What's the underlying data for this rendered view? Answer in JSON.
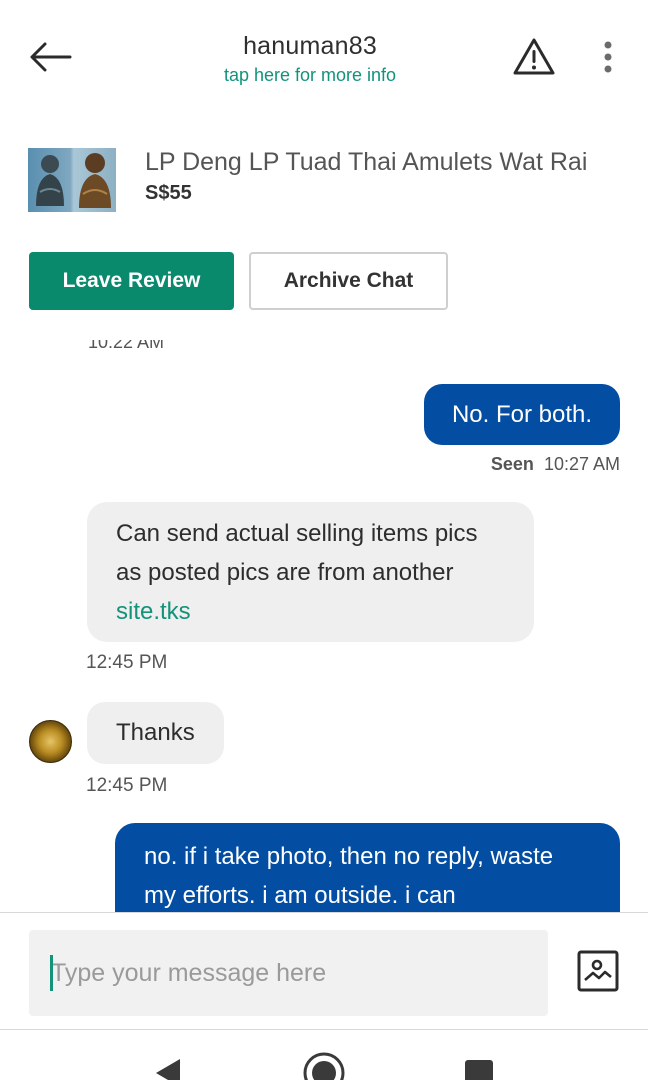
{
  "header": {
    "title": "hanuman83",
    "subtitle": "tap here for more info",
    "back_icon": "arrow-left-icon",
    "report_icon": "warning-triangle-icon",
    "more_icon": "more-vertical-icon"
  },
  "listing": {
    "title": "LP Deng LP Tuad Thai Amulets Wat Rai",
    "price": "S$55"
  },
  "actions": {
    "leave_review": "Leave Review",
    "archive_chat": "Archive Chat"
  },
  "messages": [
    {
      "direction": "outgoing",
      "text": "No. For both.",
      "status": "Seen",
      "time": "10:27 AM"
    },
    {
      "direction": "incoming",
      "text_before_link": "Can send actual selling items pics as posted pics are from another ",
      "link": "site.tks",
      "time": "12:45 PM"
    },
    {
      "direction": "incoming",
      "text": "Thanks",
      "time": "12:45 PM"
    },
    {
      "direction": "outgoing",
      "text": "no. if i take photo, then no reply, waste my efforts. i am outside. i can"
    }
  ],
  "composer": {
    "placeholder": "Type your message here",
    "value": "",
    "photo_icon": "image-icon"
  },
  "colors": {
    "accent": "#0a8a6d",
    "link": "#12937a",
    "outgoing_bubble": "#034da2",
    "incoming_bubble": "#efefef"
  }
}
